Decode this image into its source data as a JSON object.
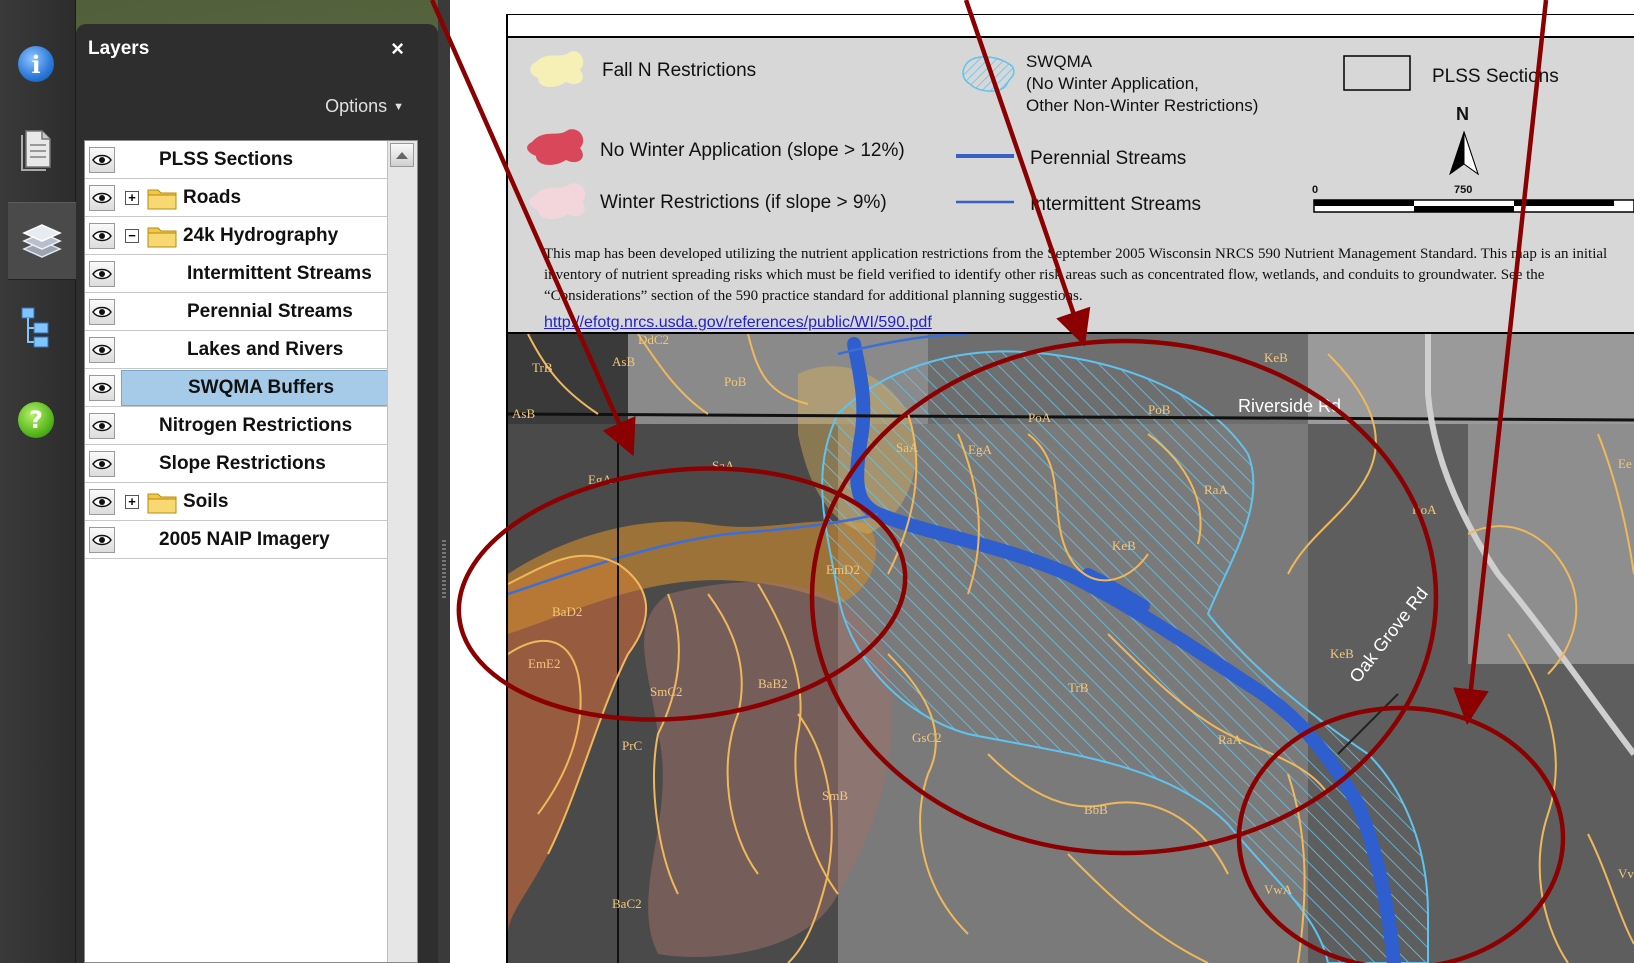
{
  "panel": {
    "title": "Layers",
    "close_glyph": "×",
    "options_label": "Options"
  },
  "rail": {
    "icons": [
      "info-icon",
      "pages-icon",
      "layers-icon",
      "model-tree-icon",
      "help-icon"
    ]
  },
  "layers": [
    {
      "label": "PLSS Sections"
    },
    {
      "label": "Roads"
    },
    {
      "label": "24k Hydrography"
    },
    {
      "label": "Intermittent Streams"
    },
    {
      "label": "Perennial Streams"
    },
    {
      "label": "Lakes and Rivers"
    },
    {
      "label": "SWQMA Buffers",
      "selected": true
    },
    {
      "label": "Nitrogen Restrictions"
    },
    {
      "label": "Slope Restrictions"
    },
    {
      "label": "Soils"
    },
    {
      "label": "2005 NAIP Imagery"
    }
  ],
  "legend": {
    "fall_n": "Fall N Restrictions",
    "no_winter": "No Winter Application (slope > 12%)",
    "winter_restr": "Winter Restrictions (if slope > 9%)",
    "swqma_1": "SWQMA",
    "swqma_2": "(No Winter Application,",
    "swqma_3": "Other Non-Winter Restrictions)",
    "perennial": "Perennial Streams",
    "intermittent": "Intermittent Streams",
    "plss": "PLSS Sections",
    "north": "N",
    "scale_0": "0",
    "scale_750": "750",
    "note": "This map has been developed utilizing the nutrient application restrictions from the September 2005 Wisconsin NRCS 590 Nutrient Management Standard. This map is an initial inventory of nutrient spreading risks which must be field verified to identify other risk areas such as concentrated flow, wetlands, and conduits to groundwater. See the “Considerations” section of the 590 practice standard for additional planning suggestions.",
    "link": "http://efotg.nrcs.usda.gov/references/public/WI/590.pdf"
  },
  "map": {
    "road_label_1": "Riverside Rd",
    "road_label_2": "Oak Grove Rd",
    "soils": [
      "TrB",
      "AsB",
      "DdC2",
      "PoB",
      "AsB",
      "PoA",
      "SaA",
      "EgA",
      "PoB",
      "KeB",
      "RaA",
      "EgA",
      "SaA",
      "KeB",
      "RoA",
      "EmD2",
      "BaD2",
      "EmE2",
      "SmC2",
      "BaB2",
      "PrC",
      "TrB",
      "GsC2",
      "RaA",
      "KeB",
      "SmB",
      "BbB",
      "VwA",
      "BaC2",
      "Ee",
      "Vv"
    ]
  },
  "colors": {
    "annotation": "#8b0000",
    "swqma": "#5fc3f0",
    "stream": "#3460c8",
    "soil_line": "#f0b85a"
  }
}
